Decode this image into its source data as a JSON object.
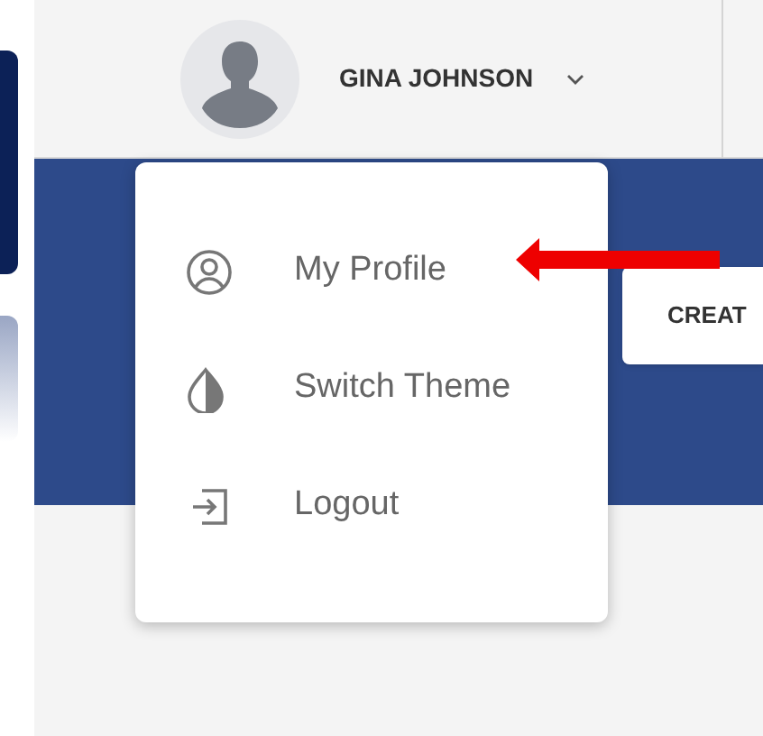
{
  "header": {
    "user_name": "GINA JOHNSON"
  },
  "user_menu": {
    "items": [
      {
        "label": "My Profile"
      },
      {
        "label": "Switch Theme"
      },
      {
        "label": "Logout"
      }
    ]
  },
  "create_button": {
    "label": "CREAT"
  }
}
